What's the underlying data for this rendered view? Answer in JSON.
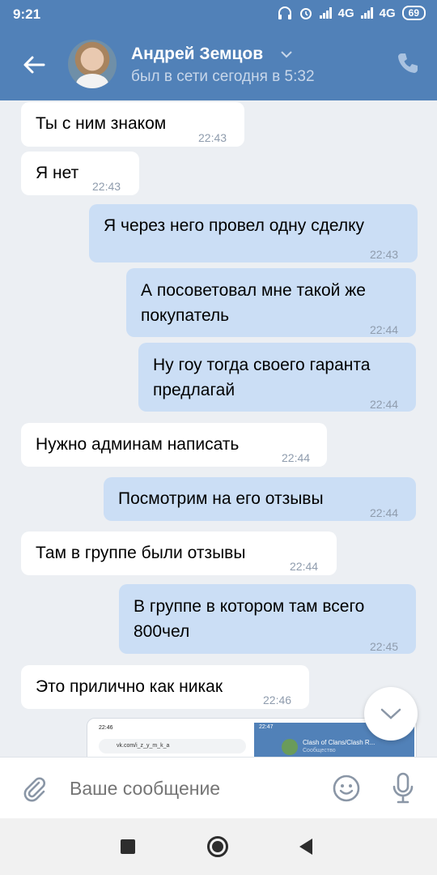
{
  "status": {
    "time": "9:21",
    "net1": "4G",
    "net2": "4G",
    "battery": "69"
  },
  "header": {
    "name": "Андрей Земцов",
    "last_seen": "был в сети сегодня в 5:32"
  },
  "messages": [
    {
      "dir": "in",
      "text": "Ты с ним знаком",
      "time": "22:43"
    },
    {
      "dir": "in",
      "text": "Я нет",
      "time": "22:43"
    },
    {
      "dir": "out",
      "text": "Я через него провел одну сделку",
      "time": "22:43"
    },
    {
      "dir": "out",
      "text": "А посоветовал мне такой же покупатель",
      "time": "22:44"
    },
    {
      "dir": "out",
      "text": "Ну гоу тогда своего гаранта предлагай",
      "time": "22:44"
    },
    {
      "dir": "in",
      "text": "Нужно админам написать",
      "time": "22:44"
    },
    {
      "dir": "out",
      "text": "Посмотрим на его отзывы",
      "time": "22:44"
    },
    {
      "dir": "in",
      "text": "Там в группе были отзывы",
      "time": "22:44"
    },
    {
      "dir": "out",
      "text": "В группе в котором там всего 800чел",
      "time": "22:45"
    },
    {
      "dir": "in",
      "text": "Это прилично как никак",
      "time": "22:46"
    }
  ],
  "preview": {
    "left_time": "22:46",
    "left_url": "vk.com/i_z_y_m_k_a",
    "right_time": "22:47",
    "right_title": "Clash of Clans/Clash R...",
    "right_sub": "Сообщество"
  },
  "composer": {
    "placeholder": "Ваше сообщение"
  },
  "colors": {
    "header": "#5181b8",
    "incoming": "#ffffff",
    "outgoing": "#cbdef5",
    "background": "#eceff3"
  }
}
